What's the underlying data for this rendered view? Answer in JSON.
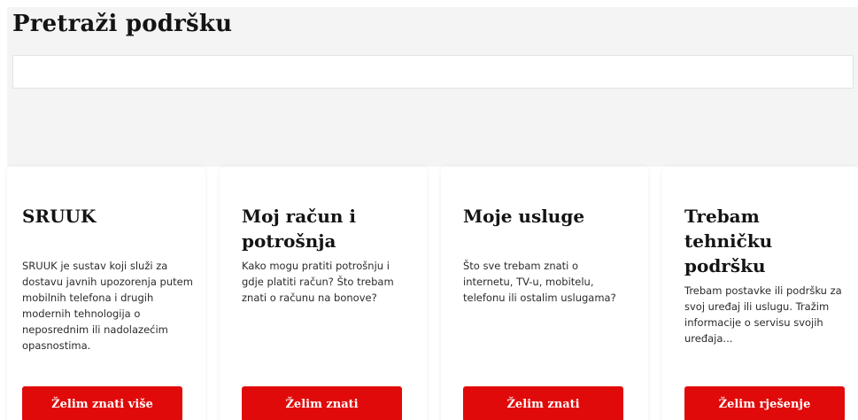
{
  "header": {
    "title": "Pretraži podršku"
  },
  "search": {
    "value": "",
    "placeholder": ""
  },
  "cards": [
    {
      "title": "SRUUK",
      "text": "SRUUK je sustav koji služi za dostavu javnih upozorenja putem mobilnih telefona i drugih modernih tehnologija o neposrednim ili nadolazećim opasnostima.",
      "button": "Želim znati više"
    },
    {
      "title": "Moj račun i potrošnja",
      "text": "Kako mogu pratiti potrošnju i gdje platiti račun? Što trebam znati o računu na bonove?",
      "button": "Želim znati"
    },
    {
      "title": "Moje usluge",
      "text": "Što sve trebam znati o internetu, TV-u, mobitelu, telefonu ili ostalim uslugama?",
      "button": "Želim znati"
    },
    {
      "title": "Trebam tehničku podršku",
      "text": "Trebam postavke ili podršku za svoj uređaj ili uslugu. Tražim informacije o servisu svojih uređaja...",
      "button": "Želim rješenje"
    }
  ],
  "colors": {
    "accent": "#e10a0a",
    "band_background": "#f4f4f4",
    "card_background": "#ffffff"
  }
}
